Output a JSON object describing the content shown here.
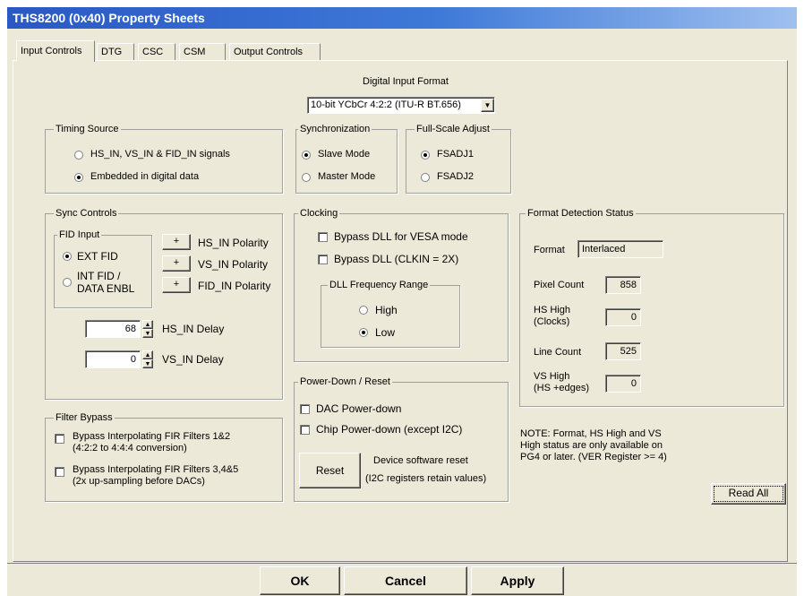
{
  "window": {
    "title": "THS8200 (0x40) Property Sheets"
  },
  "tabs": [
    "Input Controls",
    "DTG",
    "CSC",
    "CSM",
    "Output Controls"
  ],
  "digital_input_format": {
    "label": "Digital Input Format",
    "selected": "10-bit YCbCr 4:2:2 (ITU-R BT.656)"
  },
  "timing_source": {
    "title": "Timing Source",
    "options": [
      "HS_IN, VS_IN & FID_IN signals",
      "Embedded in digital data"
    ],
    "selected_index": 1
  },
  "synchronization": {
    "title": "Synchronization",
    "options": [
      "Slave Mode",
      "Master Mode"
    ],
    "selected_index": 0
  },
  "full_scale_adjust": {
    "title": "Full-Scale Adjust",
    "options": [
      "FSADJ1",
      "FSADJ2"
    ],
    "selected_index": 0
  },
  "sync_controls": {
    "title": "Sync Controls",
    "fid_input": {
      "title": "FID Input",
      "option1": "EXT FID",
      "option2_line1": "INT FID /",
      "option2_line2": "DATA ENBL",
      "selected_index": 0
    },
    "polarity": [
      {
        "sign": "+",
        "label": "HS_IN Polarity"
      },
      {
        "sign": "+",
        "label": "VS_IN Polarity"
      },
      {
        "sign": "+",
        "label": "FID_IN Polarity"
      }
    ],
    "hs_delay": {
      "value": "68",
      "label": "HS_IN Delay"
    },
    "vs_delay": {
      "value": "0",
      "label": "VS_IN Delay"
    }
  },
  "filter_bypass": {
    "title": "Filter Bypass",
    "item1_line1": "Bypass Interpolating FIR Filters 1&2",
    "item1_line2": "(4:2:2 to 4:4:4 conversion)",
    "item2_line1": "Bypass Interpolating FIR Filters 3,4&5",
    "item2_line2": "(2x up-sampling before DACs)"
  },
  "clocking": {
    "title": "Clocking",
    "bypass_vesa": "Bypass DLL for VESA mode",
    "bypass_dll": "Bypass DLL (CLKIN = 2X)",
    "dll_range": {
      "title": "DLL Frequency Range",
      "options": [
        "High",
        "Low"
      ],
      "selected_index": 1
    }
  },
  "power_down": {
    "title": "Power-Down / Reset",
    "dac": "DAC Power-down",
    "chip": "Chip Power-down (except I2C)",
    "reset_button": "Reset",
    "reset_desc_line1": "Device software reset",
    "reset_desc_line2": "(I2C registers retain values)"
  },
  "format_detection": {
    "title": "Format Detection Status",
    "format_label": "Format",
    "format_value": "Interlaced",
    "pixel_count_label": "Pixel Count",
    "pixel_count": "858",
    "hs_high_line1": "HS High",
    "hs_high_line2": "(Clocks)",
    "hs_high": "0",
    "line_count_label": "Line Count",
    "line_count": "525",
    "vs_high_line1": "VS High",
    "vs_high_line2": "(HS +edges)",
    "vs_high": "0"
  },
  "note": {
    "line1": "NOTE: Format, HS High and VS",
    "line2": "High status are only available on",
    "line3": "PG4 or later.  (VER Register >= 4)"
  },
  "read_all_button": "Read All",
  "dialog_buttons": {
    "ok": "OK",
    "cancel": "Cancel",
    "apply": "Apply"
  }
}
